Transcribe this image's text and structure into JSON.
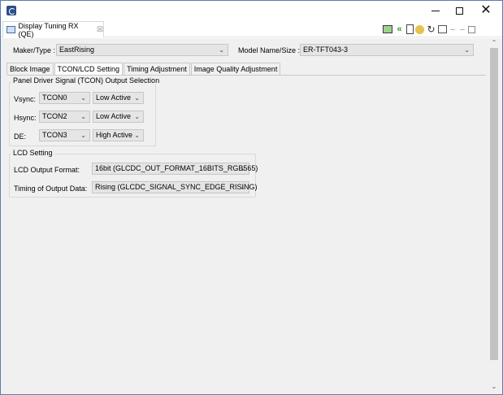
{
  "window": {
    "title": "",
    "controls": {
      "minimize": "—",
      "maximize": "☐",
      "close": "✕"
    }
  },
  "view": {
    "tab_title": "Display Tuning RX (QE)",
    "tab_close": "☒",
    "toolbar_icons": [
      "monitor-icon",
      "back-arrows-icon",
      "document-icon",
      "config-icon",
      "refresh-icon",
      "frame-icon",
      "view-minimize-icon",
      "view-maximize-icon"
    ]
  },
  "form": {
    "maker_label": "Maker/Type :",
    "maker_value": "EastRising",
    "model_label": "Model Name/Size :",
    "model_value": "ER-TFT043-3"
  },
  "tabs": [
    {
      "label": "Block Image"
    },
    {
      "label": "TCON/LCD Setting"
    },
    {
      "label": "Timing Adjustment"
    },
    {
      "label": "Image Quality Adjustment"
    }
  ],
  "active_tab": "TCON/LCD Setting",
  "tcon_group": {
    "title": "Panel Driver Signal (TCON) Output Selection",
    "rows": [
      {
        "label": "Vsync:",
        "tcon": "TCON0",
        "polarity": "Low Active"
      },
      {
        "label": "Hsync:",
        "tcon": "TCON2",
        "polarity": "Low Active"
      },
      {
        "label": "DE:",
        "tcon": "TCON3",
        "polarity": "High Active"
      }
    ]
  },
  "lcd_group": {
    "title": "LCD Setting",
    "output_format_label": "LCD Output Format:",
    "output_format_value": "16bit (GLCDC_OUT_FORMAT_16BITS_RGB565)",
    "timing_label": "Timing of Output Data:",
    "timing_value": "Rising (GLCDC_SIGNAL_SYNC_EDGE_RISING)"
  },
  "colors": {
    "window_border": "#5a7fa8",
    "panel_bg": "#f0f0f0",
    "combo_bg": "#e5e5e5"
  }
}
